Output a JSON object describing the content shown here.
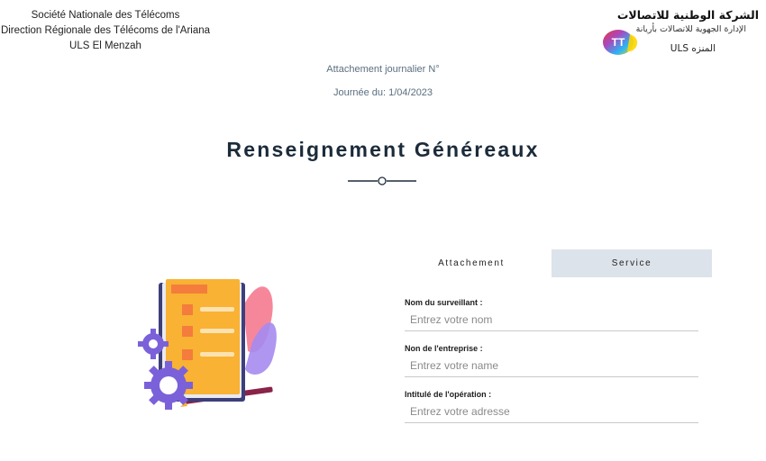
{
  "header": {
    "left_lines": [
      "Société Nationale des Télécoms",
      "Direction Régionale des Télécoms de l'Ariana",
      "ULS El Menzah"
    ],
    "right_title": "الشركة الوطنية للاتصالات",
    "right_sub": "الإدارة الجهوية للاتصالات بأريانة",
    "right_sub2": "المنزه ULS",
    "logo_text": "TT",
    "logo_icon": "tunisie-telecom-logo"
  },
  "attachment": {
    "number_label": "Attachement journalier N°",
    "day_label": "Journée du: 1/04/2023"
  },
  "page": {
    "title": "Renseignement Généreaux"
  },
  "tabs": [
    {
      "label": "Attachement",
      "active": true
    },
    {
      "label": "Service",
      "active": false
    }
  ],
  "form": {
    "fields": [
      {
        "label": "Nom du surveillant :",
        "placeholder": "Entrez votre nom",
        "value": ""
      },
      {
        "label": "Non de l'entreprise :",
        "placeholder": "Entrez votre name",
        "value": ""
      },
      {
        "label": "Intitulé de l'opération :",
        "placeholder": "Entrez votre adresse",
        "value": ""
      }
    ]
  },
  "colors": {
    "title": "#1b2b3a",
    "muted_text": "#5a6f80",
    "tab_inactive_bg": "#dde3ea",
    "illustration_orange": "#f9b233",
    "illustration_purple": "#7b61d9",
    "illustration_pink": "#f4728a"
  },
  "illustration": {
    "icon": "document-checklist-with-gears-illustration"
  }
}
